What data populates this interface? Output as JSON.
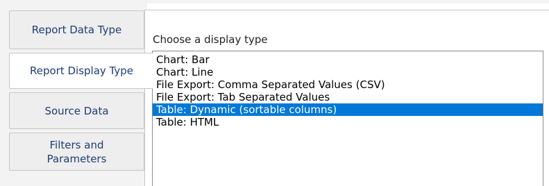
{
  "tabs": [
    {
      "label": "Report Data Type",
      "active": false
    },
    {
      "label": "Report Display Type",
      "active": true
    },
    {
      "label": "Source Data",
      "active": false
    },
    {
      "label": "Filters and\nParameters",
      "active": false
    }
  ],
  "panel": {
    "heading": "Choose a display type",
    "options": [
      "Chart: Bar",
      "Chart: Line",
      "File Export: Comma Separated Values (CSV)",
      "File Export: Tab Separated Values",
      "Table: Dynamic (sortable columns)",
      "Table: HTML"
    ],
    "selected_option": "Table: Dynamic (sortable columns)"
  },
  "colors": {
    "tab_text": "#1e3c78",
    "selection_background": "#0078d7",
    "selection_text": "#ffffff",
    "tab_background": "#eeeeee",
    "border": "#c6c6c6"
  }
}
